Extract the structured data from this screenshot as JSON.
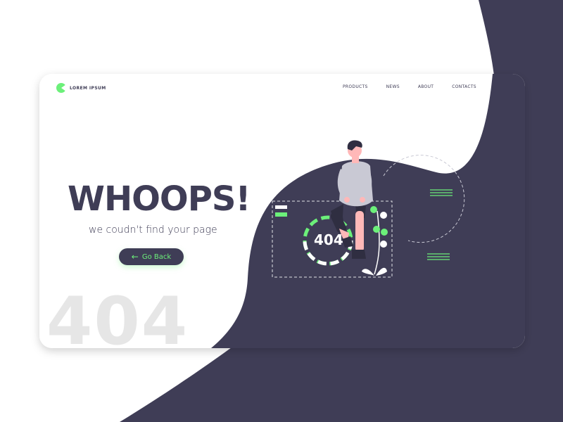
{
  "brand": {
    "name": "LOREM IPSUM",
    "logo_color": "#6cf07a"
  },
  "nav": {
    "items": [
      "PRODUCTS",
      "NEWS",
      "ABOUT",
      "CONTACTS"
    ]
  },
  "hero": {
    "headline": "WHOOPS!",
    "subline": "we coudn't find your page",
    "button_label": "Go Back",
    "button_icon": "arrow-left-icon",
    "background_number": "404"
  },
  "illustration": {
    "badge_text": "404"
  },
  "colors": {
    "dark": "#3f3d56",
    "accent": "#6cf07a",
    "light_gray": "#e6e6e6",
    "background": "#ffffff"
  }
}
